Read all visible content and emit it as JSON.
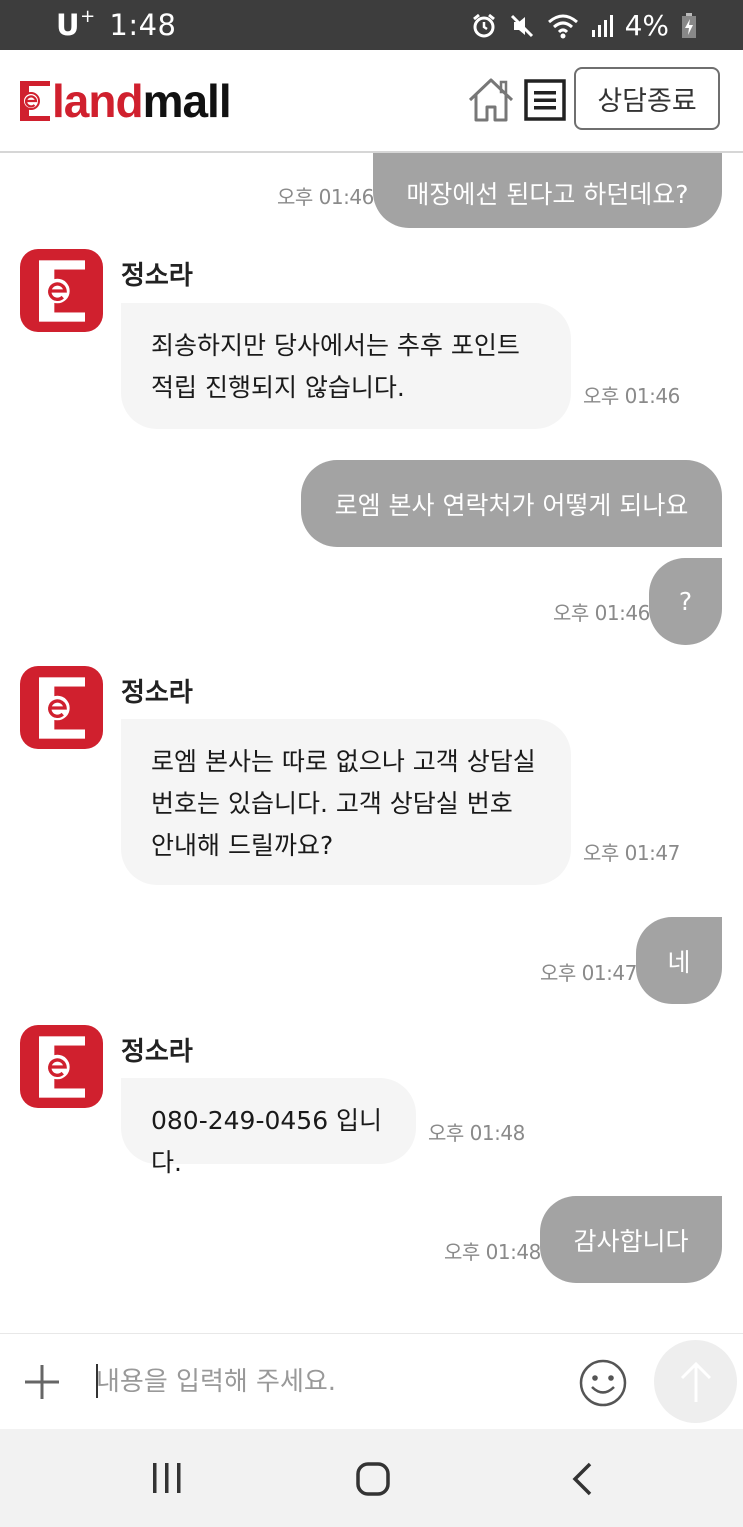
{
  "status_bar": {
    "carrier": "U",
    "carrier_sup": "+",
    "time": "1:48",
    "battery": "4%",
    "icons": [
      "alarm-icon",
      "mute-icon",
      "wifi-icon",
      "signal-icon",
      "battery-icon"
    ]
  },
  "header": {
    "logo_prefix": "land",
    "logo_suffix": "mall",
    "end_chat_label": "상담종료"
  },
  "colors": {
    "brand_red": "#d0202e",
    "outgoing_bubble": "#a3a3a3",
    "incoming_bubble": "#f5f5f5"
  },
  "messages": [
    {
      "type": "out",
      "text": "매장에선 된다고 하던데요?",
      "time": "오후 01:46"
    },
    {
      "type": "in",
      "sender": "정소라",
      "lines": [
        "죄송하지만 당사에서는 추후 포인트",
        "적립 진행되지 않습니다."
      ],
      "time": "오후 01:46"
    },
    {
      "type": "out",
      "text": "로엠 본사 연락처가 어떻게 되나요"
    },
    {
      "type": "out",
      "text": "?",
      "time": "오후 01:46"
    },
    {
      "type": "in",
      "sender": "정소라",
      "lines": [
        "로엠 본사는 따로 없으나 고객 상담실",
        "번호는 있습니다. 고객 상담실 번호",
        "안내해 드릴까요?"
      ],
      "time": "오후 01:47"
    },
    {
      "type": "out",
      "text": "네",
      "time": "오후 01:47"
    },
    {
      "type": "in",
      "sender": "정소라",
      "lines": [
        "080-249-0456 입니다."
      ],
      "time": "오후 01:48"
    },
    {
      "type": "out",
      "text": "감사합니다",
      "time": "오후 01:48"
    }
  ],
  "input": {
    "placeholder": "내용을 입력해 주세요."
  }
}
